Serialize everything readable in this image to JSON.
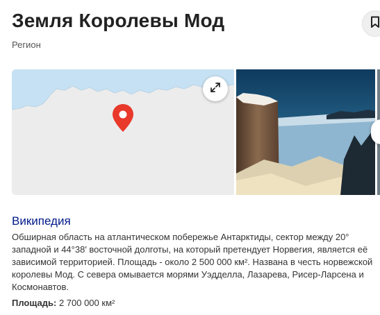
{
  "header": {
    "title": "Земля Королевы Мод",
    "subtitle": "Регион"
  },
  "icons": {
    "bookmark": "bookmark-icon",
    "expand": "expand-icon",
    "map_pin": "map-pin-icon"
  },
  "colors": {
    "map_water": "#c6e1f3",
    "map_land": "#ececec",
    "pin": "#e8392b",
    "link": "#001a8a"
  },
  "wikipedia": {
    "heading": "Википедия",
    "text": "Обширная область на атлантическом побережье Антарктиды, сектор между 20° западной и 44°38′ восточной долготы, на который претендует Норвегия, является её зависимой территорией. Площадь - около 2 500 000 км². Названа в честь норвежской королевы Мод. С севера омывается морями Уэдделла, Лазарева, Рисер-Ларсена и Космонавтов."
  },
  "facts": {
    "area_label": "Площадь:",
    "area_value": "2 700 000 км²"
  }
}
